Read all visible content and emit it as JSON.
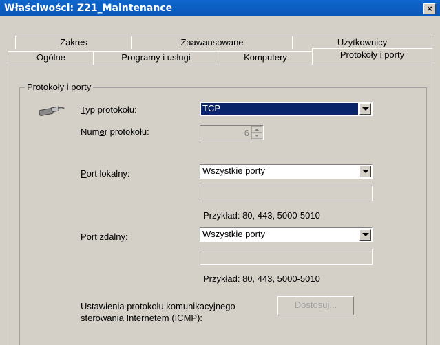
{
  "window": {
    "title": "Właściwości: Z21_Maintenance",
    "close_glyph": "×"
  },
  "tabs": {
    "row1": [
      "Zakres",
      "Zaawansowane",
      "Użytkownicy"
    ],
    "row2": [
      "Ogólne",
      "Programy i usługi",
      "Komputery",
      "Protokoły i porty"
    ],
    "selected": "Protokoły i porty"
  },
  "group": {
    "label": "Protokoły i porty",
    "icon": "network-cable-icon"
  },
  "protocol_type": {
    "label_pre": "",
    "label_u": "T",
    "label_post": "yp protokołu:",
    "value": "TCP"
  },
  "protocol_number": {
    "label_pre": "Num",
    "label_u": "e",
    "label_post": "r protokołu:",
    "value": "6"
  },
  "local_port": {
    "label_pre": "",
    "label_u": "P",
    "label_post": "ort lokalny:",
    "value": "Wszystkie porty",
    "example": "Przykład: 80, 443, 5000-5010"
  },
  "remote_port": {
    "label_pre": "P",
    "label_u": "o",
    "label_post": "rt zdalny:",
    "value": "Wszystkie porty",
    "example": "Przykład: 80, 443, 5000-5010"
  },
  "icmp": {
    "label_line1": "Ustawienia protokołu komunikacyjnego",
    "label_line2": "sterowania Internetem (ICMP):",
    "button_pre": "Dostos",
    "button_u": "u",
    "button_post": "j..."
  }
}
